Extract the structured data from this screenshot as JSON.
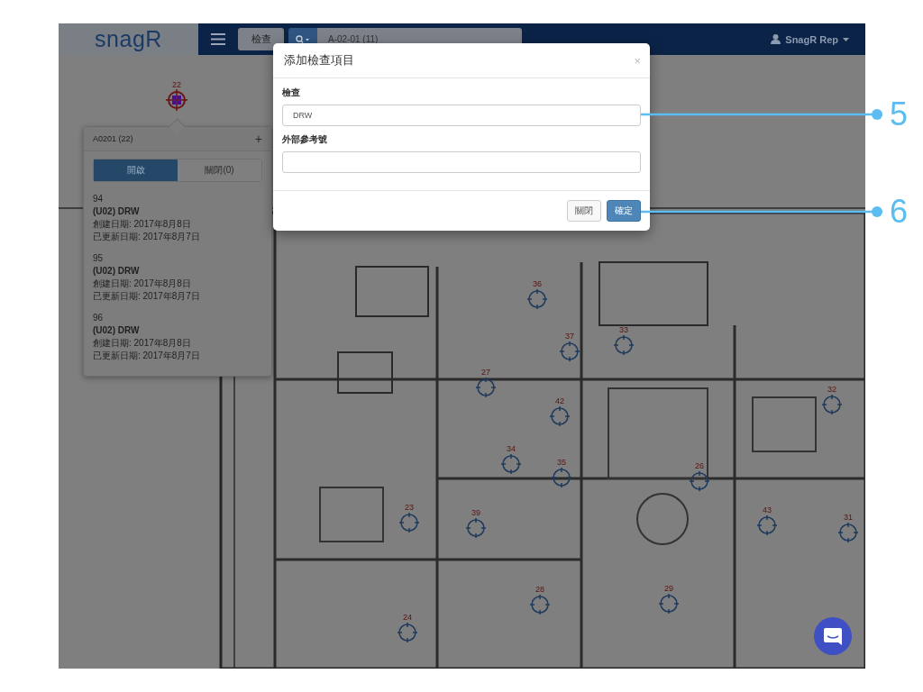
{
  "navbar": {
    "logo": "snagR",
    "inspection_button": "檢查",
    "search_value": "A-02-01 (11)",
    "user": "SnagR Rep"
  },
  "pins": [
    {
      "label": "22",
      "kind": "selected"
    },
    {
      "label": "36",
      "kind": "normal"
    },
    {
      "label": "37",
      "kind": "normal"
    },
    {
      "label": "33",
      "kind": "normal"
    },
    {
      "label": "27",
      "kind": "normal"
    },
    {
      "label": "42",
      "kind": "normal"
    },
    {
      "label": "34",
      "kind": "normal"
    },
    {
      "label": "35",
      "kind": "normal"
    },
    {
      "label": "26",
      "kind": "normal"
    },
    {
      "label": "28",
      "kind": "normal"
    },
    {
      "label": "29",
      "kind": "normal"
    },
    {
      "label": "43",
      "kind": "normal"
    },
    {
      "label": "31",
      "kind": "normal"
    },
    {
      "label": "32",
      "kind": "normal"
    },
    {
      "label": "23",
      "kind": "normal"
    },
    {
      "label": "39",
      "kind": "normal"
    },
    {
      "label": "24",
      "kind": "normal"
    }
  ],
  "popover": {
    "title": "A0201 (22)",
    "add": "+",
    "tabs": [
      {
        "label": "開啟",
        "selected": true
      },
      {
        "label": "關閉(0)",
        "selected": false
      }
    ],
    "items": [
      {
        "number": "94",
        "title": "(U02) DRW",
        "created": "創建日期: 2017年8月8日",
        "updated": "已更新日期: 2017年8月7日"
      },
      {
        "number": "95",
        "title": "(U02) DRW",
        "created": "創建日期: 2017年8月8日",
        "updated": "已更新日期: 2017年8月7日"
      },
      {
        "number": "96",
        "title": "(U02) DRW",
        "created": "創建日期: 2017年8月8日",
        "updated": "已更新日期: 2017年8月7日"
      }
    ]
  },
  "dialog": {
    "title": "添加檢查項目",
    "close": "×",
    "fields": [
      {
        "label": "檢查",
        "value": "DRW"
      },
      {
        "label": "外部參考號"
      }
    ],
    "buttons": [
      {
        "label": "關閉",
        "kind": "default"
      },
      {
        "label": "確定",
        "kind": "primary"
      }
    ]
  },
  "callouts": [
    "5",
    "6"
  ]
}
